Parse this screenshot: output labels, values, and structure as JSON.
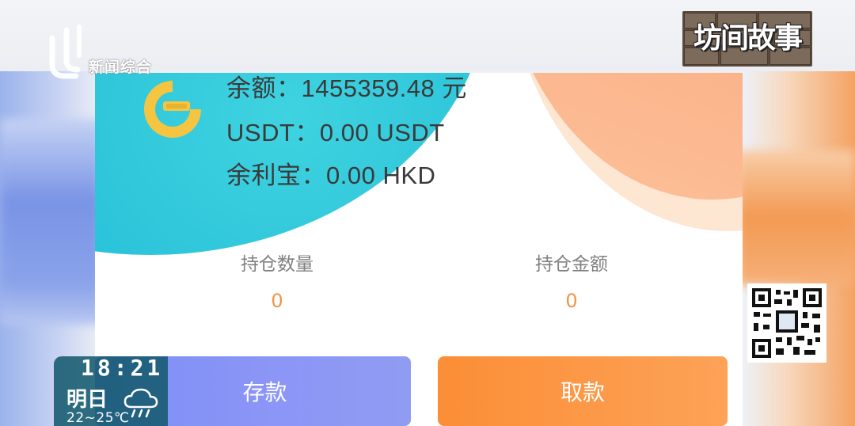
{
  "balances": {
    "main": "余额：1455359.48 元",
    "usdt": "USDT：0.00 USDT",
    "yulibao": "余利宝：0.00 HKD"
  },
  "holdings": {
    "quantity_label": "持仓数量",
    "quantity_value": "0",
    "amount_label": "持仓金额",
    "amount_value": "0"
  },
  "actions": {
    "deposit_label": "存款",
    "withdraw_label": "取款"
  },
  "overlay": {
    "channel_name": "新闻综合",
    "program_name": "坊间故事",
    "time": "18:21",
    "day": "明日",
    "temperature": "22~25℃",
    "weather_icon": "rain-cloud-icon"
  },
  "colors": {
    "deposit_button": "#8c96f6",
    "withdraw_button": "#fd9a48",
    "value_orange": "#f0954a",
    "accent_cyan": "#26bfd8"
  }
}
